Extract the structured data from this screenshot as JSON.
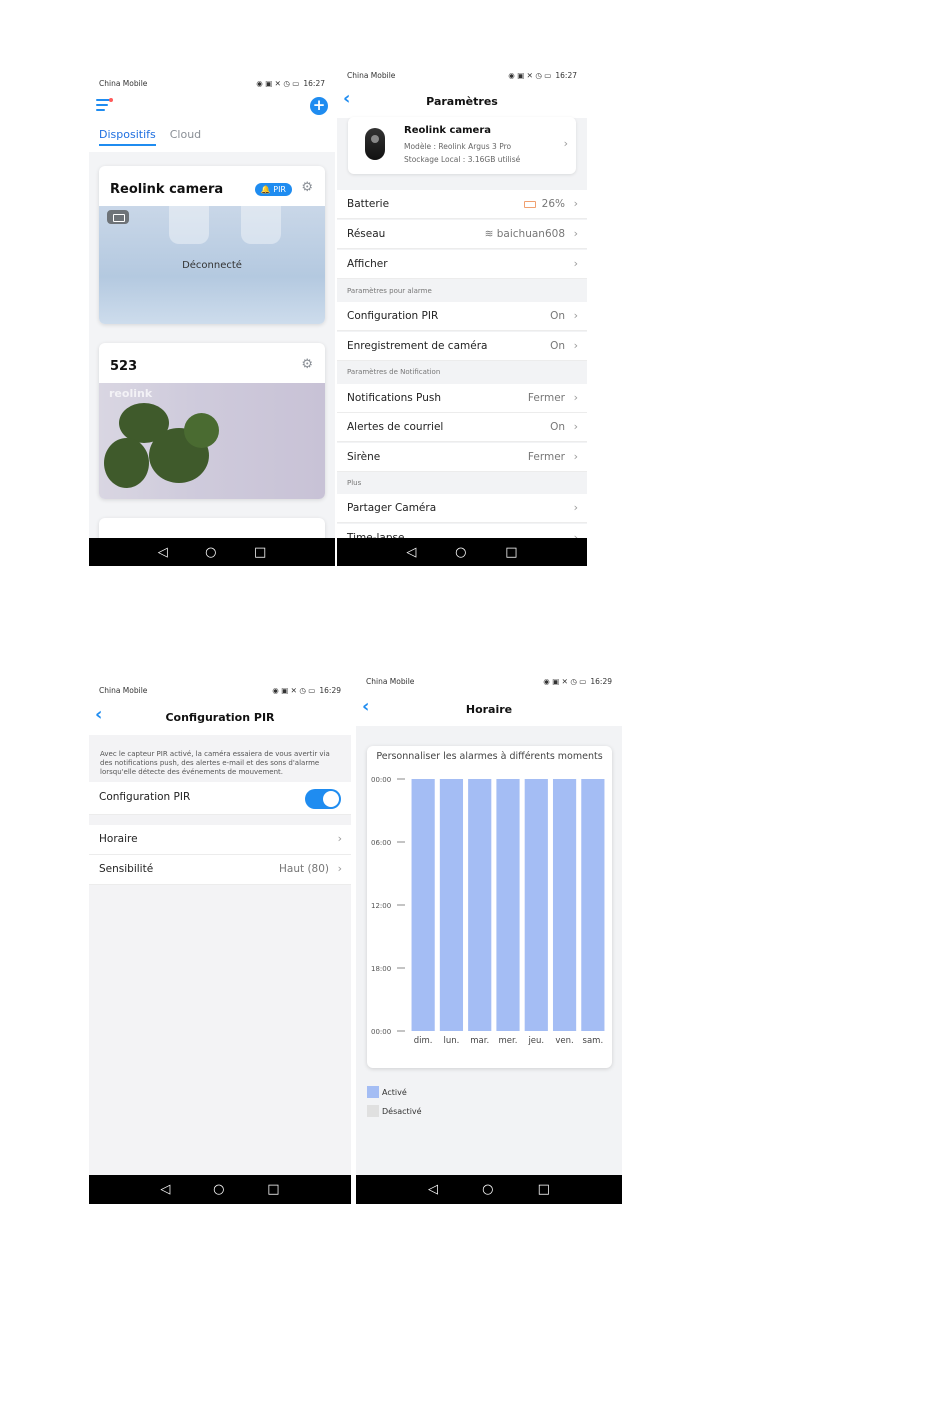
{
  "colors": {
    "accent": "#1f8cf0",
    "bar_active": "#a4bdf4",
    "bar_inactive": "#e0e0e0"
  },
  "screen1": {
    "status": {
      "carrier": "China Mobile",
      "icons": "▣ ⁴ᴳ.⫗ ≈ ⧗ ⚐ ▣",
      "right_icons": "◉ ▣ ✘ ◷ ",
      "battery": "80",
      "time": "16:27"
    },
    "tabs": [
      "Dispositifs",
      "Cloud"
    ],
    "cards": [
      {
        "name": "Reolink camera",
        "badge": "PIR",
        "status": "Déconnecté"
      },
      {
        "name": "523",
        "watermark": "reolink"
      }
    ],
    "nav": {
      "back": "◁",
      "home": "○",
      "recent": "□"
    }
  },
  "screen2": {
    "status": {
      "carrier": "China Mobile",
      "battery": "80",
      "time": "16:27"
    },
    "title": "Paramètres",
    "device": {
      "name": "Reolink camera",
      "model": "Modèle : Reolink Argus 3 Pro",
      "storage": "Stockage Local : 3.16GB utilisé"
    },
    "rows_main": [
      {
        "label": "Batterie",
        "value": "26%"
      },
      {
        "label": "Réseau",
        "value": "baichuan608"
      },
      {
        "label": "Afficher",
        "value": ""
      }
    ],
    "section_alarm": "Paramètres pour alarme",
    "rows_alarm": [
      {
        "label": "Configuration PIR",
        "value": "On"
      },
      {
        "label": "Enregistrement de caméra",
        "value": "On"
      }
    ],
    "section_notif": "Paramètres de Notification",
    "rows_notif": [
      {
        "label": "Notifications Push",
        "value": "Fermer"
      },
      {
        "label": "Alertes de courriel",
        "value": "On"
      },
      {
        "label": "Sirène",
        "value": "Fermer"
      }
    ],
    "section_more": "Plus",
    "rows_more": [
      {
        "label": "Partager Caméra",
        "value": ""
      },
      {
        "label": "Time-lapse",
        "value": ""
      }
    ]
  },
  "screen3": {
    "status": {
      "carrier": "China Mobile",
      "battery": "80",
      "time": "16:29"
    },
    "title": "Configuration PIR",
    "description": "Avec le capteur PIR activé, la caméra essaiera de vous avertir via des notifications push, des alertes e-mail et des sons d'alarme lorsqu'elle détecte des événements de mouvement.",
    "toggle_label": "Configuration PIR",
    "toggle_on": true,
    "rows": [
      {
        "label": "Horaire",
        "value": ""
      },
      {
        "label": "Sensibilité",
        "value": "Haut (80)"
      }
    ]
  },
  "screen4": {
    "status": {
      "carrier": "China Mobile",
      "battery": "80",
      "time": "16:29"
    },
    "title": "Horaire",
    "legend": {
      "active": "Activé",
      "inactive": "Désactivé"
    }
  },
  "chart_data": {
    "type": "bar",
    "title": "Personnaliser les alarmes à différents moments",
    "categories": [
      "dim.",
      "lun.",
      "mar.",
      "mer.",
      "jeu.",
      "ven.",
      "sam."
    ],
    "y_ticks": [
      "00:00",
      "06:00",
      "12:00",
      "18:00",
      "00:00"
    ],
    "series": [
      {
        "name": "Activé",
        "values": [
          24,
          24,
          24,
          24,
          24,
          24,
          24
        ]
      }
    ],
    "ylim": [
      0,
      24
    ],
    "legend_position": "bottom-left"
  }
}
